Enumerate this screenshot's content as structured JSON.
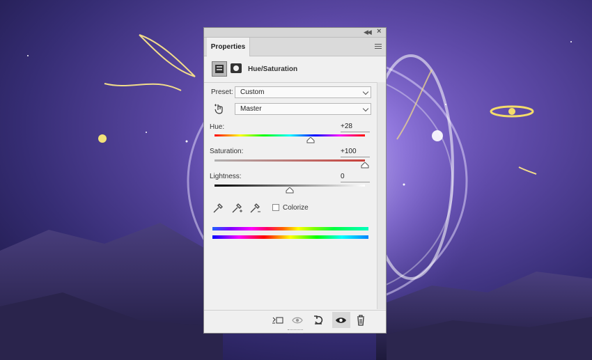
{
  "panel": {
    "tab_label": "Properties",
    "adjustment_title": "Hue/Saturation",
    "preset_label": "Preset:",
    "preset_value": "Custom",
    "channel_value": "Master",
    "hue": {
      "label": "Hue:",
      "value": "+28",
      "level": 0.578
    },
    "saturation": {
      "label": "Saturation:",
      "value": "+100",
      "level": 1.0
    },
    "lightness": {
      "label": "Lightness:",
      "value": "0",
      "level": 0.5
    },
    "colorize_label": "Colorize",
    "colorize_checked": false
  },
  "icons": {
    "collapse": "double-chevron-icon",
    "close": "close-icon",
    "panel_menu": "panel-menu-icon",
    "adjustment": "hue-saturation-icon",
    "mask": "layer-mask-icon",
    "targeted_adjust": "hand-adjust-icon",
    "eyedroppers": [
      "eyedropper-icon",
      "eyedropper-plus-icon",
      "eyedropper-minus-icon"
    ],
    "footer": [
      "clip-to-layer-icon",
      "view-previous-icon",
      "reset-icon",
      "visibility-eye-icon",
      "trash-icon"
    ]
  },
  "colors": {
    "panel_bg": "#f0f0f0",
    "saturation_track": "#c8403a"
  }
}
